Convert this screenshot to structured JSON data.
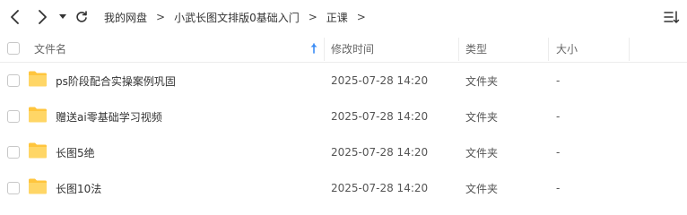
{
  "toolbar": {
    "breadcrumb": [
      "我的网盘",
      "小武长图文排版0基础入门",
      "正课"
    ],
    "separator": ">"
  },
  "columns": {
    "name": "文件名",
    "modified": "修改时间",
    "type": "类型",
    "size": "大小"
  },
  "sort": {
    "column": "name",
    "direction": "ascending"
  },
  "colors": {
    "accent": "#3b8cf5",
    "folder": "#ffc53d"
  },
  "rows": [
    {
      "name": "ps阶段配合实操案例巩固",
      "modified": "2025-07-28 14:20",
      "type": "文件夹",
      "size": "-"
    },
    {
      "name": "赠送ai零基础学习视频",
      "modified": "2025-07-28 14:20",
      "type": "文件夹",
      "size": "-"
    },
    {
      "name": "长图5绝",
      "modified": "2025-07-28 14:20",
      "type": "文件夹",
      "size": "-"
    },
    {
      "name": "长图10法",
      "modified": "2025-07-28 14:20",
      "type": "文件夹",
      "size": "-"
    }
  ]
}
